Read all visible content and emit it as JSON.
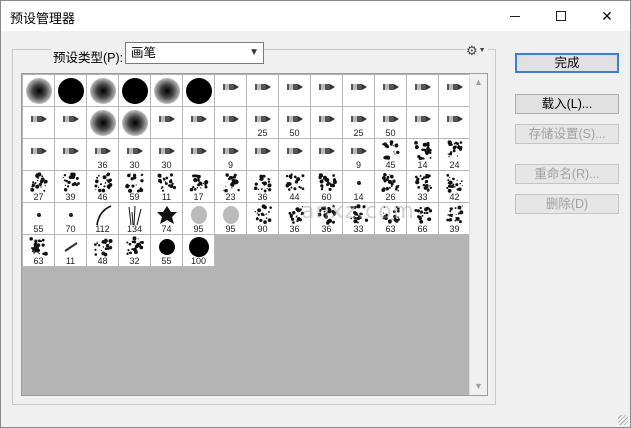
{
  "window": {
    "title": "预设管理器"
  },
  "controls": {
    "preset_type_label": "预设类型(P):",
    "preset_type_value": "画笔",
    "gear_icon": "gear-icon"
  },
  "buttons": {
    "done": "完成",
    "load": "载入(L)...",
    "save_set": "存储设置(S)...",
    "rename": "重命名(R)...",
    "delete": "删除(D)"
  },
  "watermark": "anxz.com",
  "brushes": [
    {
      "kind": "soft",
      "num": ""
    },
    {
      "kind": "hard",
      "num": ""
    },
    {
      "kind": "soft",
      "num": ""
    },
    {
      "kind": "hard",
      "num": ""
    },
    {
      "kind": "soft",
      "num": ""
    },
    {
      "kind": "hard",
      "num": ""
    },
    {
      "kind": "tool",
      "num": ""
    },
    {
      "kind": "tool",
      "num": ""
    },
    {
      "kind": "tool",
      "num": ""
    },
    {
      "kind": "tool",
      "num": ""
    },
    {
      "kind": "tool",
      "num": ""
    },
    {
      "kind": "tool",
      "num": ""
    },
    {
      "kind": "tool",
      "num": ""
    },
    {
      "kind": "tool",
      "num": ""
    },
    {
      "kind": "tool",
      "num": ""
    },
    {
      "kind": "tool",
      "num": ""
    },
    {
      "kind": "soft",
      "num": ""
    },
    {
      "kind": "soft",
      "num": ""
    },
    {
      "kind": "tool",
      "num": ""
    },
    {
      "kind": "tool",
      "num": ""
    },
    {
      "kind": "tool",
      "num": ""
    },
    {
      "kind": "tool",
      "num": "25"
    },
    {
      "kind": "tool",
      "num": "50"
    },
    {
      "kind": "tool",
      "num": ""
    },
    {
      "kind": "tool",
      "num": "25"
    },
    {
      "kind": "tool",
      "num": "50"
    },
    {
      "kind": "tool",
      "num": ""
    },
    {
      "kind": "tool",
      "num": ""
    },
    {
      "kind": "tool",
      "num": ""
    },
    {
      "kind": "tool",
      "num": ""
    },
    {
      "kind": "tool",
      "num": "36"
    },
    {
      "kind": "tool",
      "num": "30"
    },
    {
      "kind": "tool",
      "num": "30"
    },
    {
      "kind": "tool",
      "num": ""
    },
    {
      "kind": "tool",
      "num": "9"
    },
    {
      "kind": "tool",
      "num": ""
    },
    {
      "kind": "tool",
      "num": ""
    },
    {
      "kind": "tool",
      "num": ""
    },
    {
      "kind": "tool",
      "num": "9"
    },
    {
      "kind": "splat",
      "num": "45"
    },
    {
      "kind": "splat",
      "num": "14"
    },
    {
      "kind": "splat",
      "num": "24"
    },
    {
      "kind": "splat",
      "num": "27"
    },
    {
      "kind": "splat",
      "num": "39"
    },
    {
      "kind": "splat",
      "num": "46"
    },
    {
      "kind": "splat",
      "num": "59"
    },
    {
      "kind": "splat",
      "num": "11"
    },
    {
      "kind": "splat",
      "num": "17"
    },
    {
      "kind": "splat",
      "num": "23"
    },
    {
      "kind": "splat",
      "num": "36"
    },
    {
      "kind": "splat",
      "num": "44"
    },
    {
      "kind": "splat",
      "num": "60"
    },
    {
      "kind": "dot",
      "num": "14"
    },
    {
      "kind": "splat",
      "num": "26"
    },
    {
      "kind": "splat",
      "num": "33"
    },
    {
      "kind": "splat",
      "num": "42"
    },
    {
      "kind": "dot",
      "num": "55"
    },
    {
      "kind": "dot",
      "num": "70"
    },
    {
      "kind": "curve",
      "num": "112"
    },
    {
      "kind": "grass",
      "num": "134"
    },
    {
      "kind": "leaf",
      "num": "74"
    },
    {
      "kind": "softgray",
      "num": "95"
    },
    {
      "kind": "softgray",
      "num": "95"
    },
    {
      "kind": "splat",
      "num": "90"
    },
    {
      "kind": "splat",
      "num": "36"
    },
    {
      "kind": "splat",
      "num": "36"
    },
    {
      "kind": "splat",
      "num": "33"
    },
    {
      "kind": "splat",
      "num": "63"
    },
    {
      "kind": "splat",
      "num": "66"
    },
    {
      "kind": "splat",
      "num": "39"
    },
    {
      "kind": "splat",
      "num": "63"
    },
    {
      "kind": "stroke",
      "num": "11"
    },
    {
      "kind": "splat",
      "num": "48"
    },
    {
      "kind": "splat",
      "num": "32"
    },
    {
      "kind": "hardsmall",
      "num": "55"
    },
    {
      "kind": "circle",
      "num": "100"
    }
  ]
}
